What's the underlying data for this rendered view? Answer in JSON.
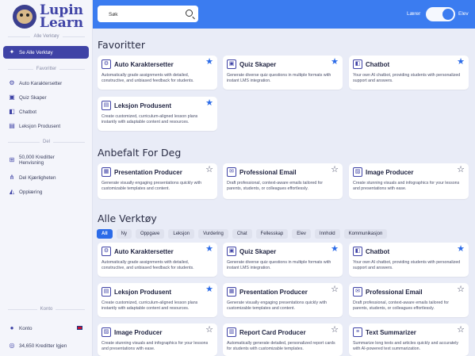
{
  "brand": {
    "name": "Lupin Learn"
  },
  "sidebar": {
    "all_tools_label": "Alle Verktøy",
    "all_tools_item": "Se Alle Verktøy",
    "favorites_label": "Favoritter",
    "favorites": [
      "Auto Karaktersetter",
      "Quiz Skaper",
      "Chatbot",
      "Leksjon Produsent"
    ],
    "share_label": "Del",
    "share": [
      "50,000 Kreditter Henvisning",
      "Del Kjærligheten",
      "Opplæring"
    ],
    "account_label": "Konto",
    "account": [
      "Konto",
      "34,650 Kreditter Igjen"
    ]
  },
  "topbar": {
    "search_placeholder": "Søk",
    "toggle_left": "Lærer",
    "toggle_right": "Elev"
  },
  "sections": {
    "favorites": "Favoritter",
    "recommended": "Anbefalt For Deg",
    "all": "Alle Verktøy"
  },
  "filters": [
    "All",
    "Ny",
    "Oppgave",
    "Leksjon",
    "Vurdering",
    "Chat",
    "Fellesskap",
    "Elev",
    "Innhold",
    "Kommunikasjon"
  ],
  "cards": {
    "auto": {
      "title": "Auto Karaktersetter",
      "desc": "Automatically grade assignments with detailed, constructive, and unbiased feedback for students."
    },
    "quiz": {
      "title": "Quiz Skaper",
      "desc": "Generate diverse quiz questions in multiple formats with instant LMS integration."
    },
    "chat": {
      "title": "Chatbot",
      "desc": "Your own AI chatbot, providing students with personalized support and answers."
    },
    "lesson": {
      "title": "Leksjon Produsent",
      "desc": "Create customized, curriculum-aligned lesson plans instantly with adaptable content and resources."
    },
    "pres": {
      "title": "Presentation Producer",
      "desc": "Generate visually engaging presentations quickly with customizable templates and content."
    },
    "email": {
      "title": "Professional Email",
      "desc": "Draft professional, context-aware emails tailored for parents, students, or colleagues effortlessly."
    },
    "image": {
      "title": "Image Producer",
      "desc": "Create stunning visuals and infographics for your lessons and presentations with ease."
    },
    "report": {
      "title": "Report Card Producer",
      "desc": "Automatically generate detailed, personalized report cards for students with customizable templates."
    },
    "summ": {
      "title": "Text Summarizer",
      "desc": "Summarize long texts and articles quickly and accurately with AI-powered text summarization."
    }
  },
  "colors": {
    "accent": "#3b7cf0",
    "brand": "#3f43a6",
    "star": "#2b6be8"
  }
}
